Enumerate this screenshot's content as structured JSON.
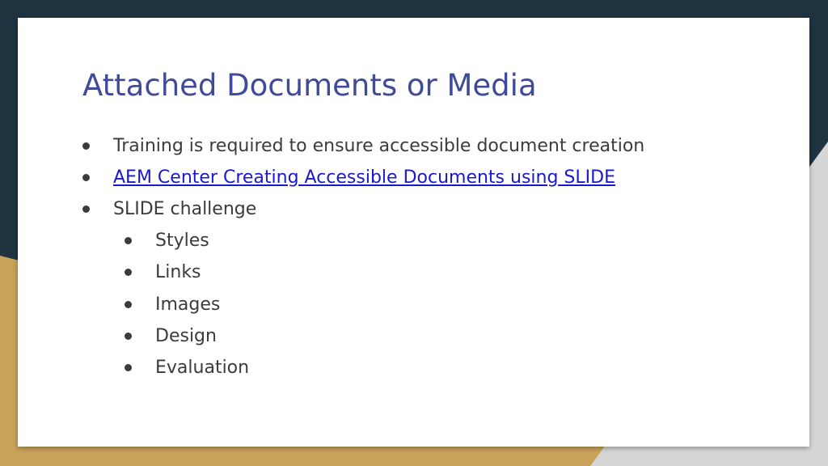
{
  "slide": {
    "title": "Attached Documents or Media",
    "bullets": [
      {
        "text": "Training is required to ensure accessible document creation",
        "level": 1,
        "link": false
      },
      {
        "text": "AEM Center Creating Accessible Documents using SLIDE",
        "level": 1,
        "link": true
      },
      {
        "text": "SLIDE challenge",
        "level": 1,
        "link": false
      },
      {
        "text": "Styles",
        "level": 2,
        "link": false
      },
      {
        "text": "Links",
        "level": 2,
        "link": false
      },
      {
        "text": "Images",
        "level": 2,
        "link": false
      },
      {
        "text": "Design",
        "level": 2,
        "link": false
      },
      {
        "text": "Evaluation",
        "level": 2,
        "link": false
      }
    ]
  },
  "colors": {
    "title": "#3f4b9a",
    "body_text": "#3b3b3b",
    "link": "#1a18cc",
    "background_dark": "#1f3340",
    "background_gold": "#c9a35a",
    "background_gray": "#d6d6d6"
  }
}
